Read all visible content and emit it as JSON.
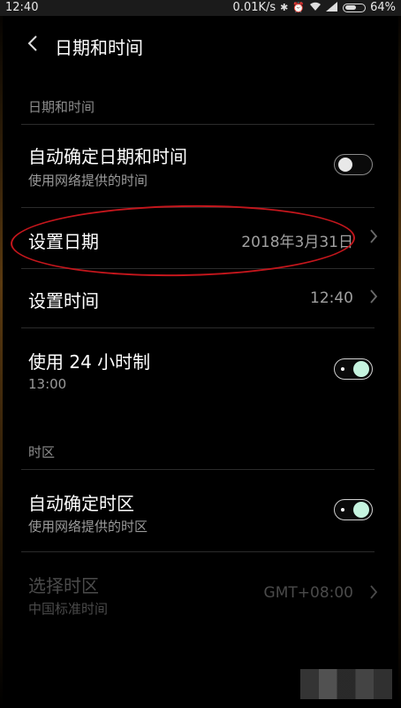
{
  "status_bar": {
    "time": "12:40",
    "net_speed": "0.01K/s",
    "battery_percent": "64%",
    "battery_level": 0.64,
    "icons": [
      "bluetooth-icon",
      "alarm-icon",
      "wifi-icon",
      "signal-icon",
      "battery-icon"
    ]
  },
  "header": {
    "title": "日期和时间",
    "back_icon": "chevron-left-icon"
  },
  "sections": {
    "date_time": "日期和时间",
    "timezone": "时区"
  },
  "rows": {
    "auto_datetime": {
      "label": "自动确定日期和时间",
      "sub": "使用网络提供的时间",
      "toggle_on": false
    },
    "set_date": {
      "label": "设置日期",
      "value": "2018年3月31日"
    },
    "set_time": {
      "label": "设置时间",
      "value": "12:40"
    },
    "use_24h": {
      "label": "使用 24 小时制",
      "sub": "13:00",
      "toggle_on": true
    },
    "auto_timezone": {
      "label": "自动确定时区",
      "sub": "使用网络提供的时区",
      "toggle_on": true
    },
    "select_timezone": {
      "label": "选择时区",
      "sub": "中国标准时间",
      "value": "GMT+08:00",
      "disabled": true
    }
  },
  "colors": {
    "background": "#000000",
    "toggle_knob_on": "#c6f4df",
    "annotation": "#c4161c"
  }
}
